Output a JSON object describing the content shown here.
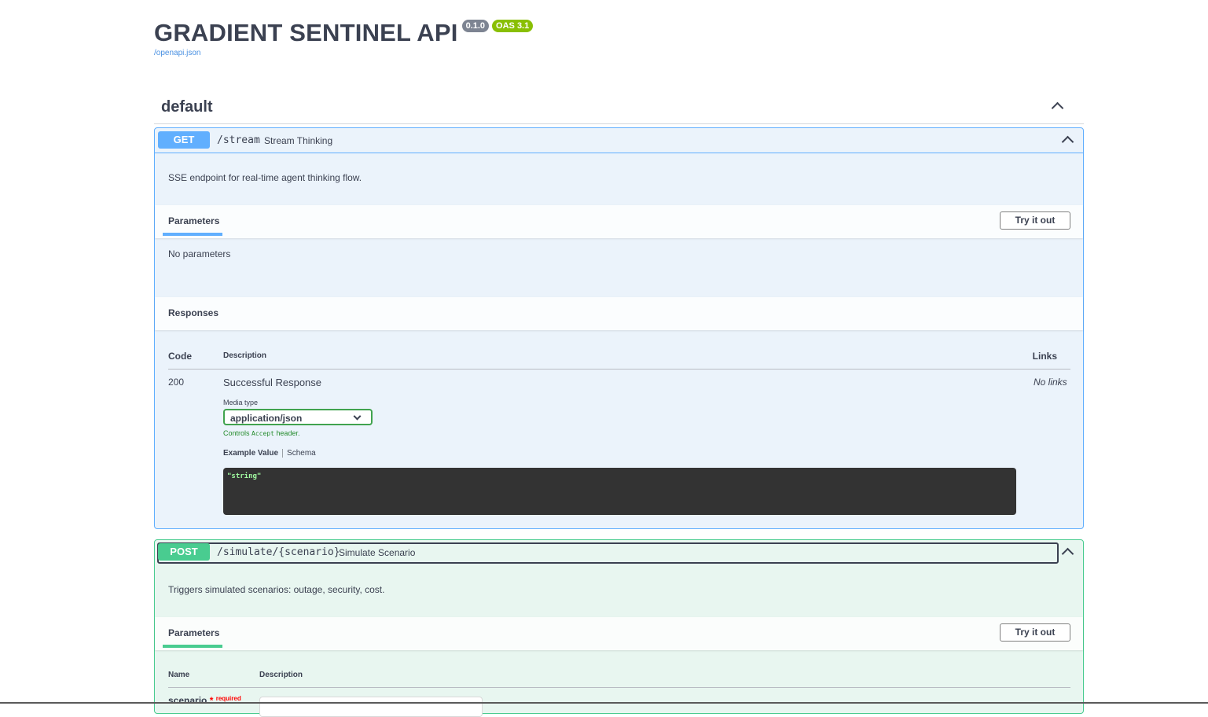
{
  "header": {
    "title": "GRADIENT SENTINEL API",
    "version_badge": "0.1.0",
    "oas_badge": "OAS 3.1",
    "spec_link": "/openapi.json"
  },
  "section": {
    "title": "default"
  },
  "operations": [
    {
      "method": "GET",
      "path": "/stream",
      "summary": "Stream Thinking",
      "description": "SSE endpoint for real-time agent thinking flow.",
      "parameters_tab": "Parameters",
      "try_button": "Try it out",
      "no_params": "No parameters",
      "responses_title": "Responses",
      "responses": {
        "col_code": "Code",
        "col_description": "Description",
        "col_links": "Links",
        "row": {
          "code": "200",
          "description": "Successful Response",
          "links": "No links",
          "media_type_label": "Media type",
          "media_type_value": "application/json",
          "controls_prefix": "Controls ",
          "controls_code": "Accept",
          "controls_suffix": " header.",
          "example_tab": "Example Value",
          "schema_tab": "Schema",
          "example_code": "\"string\""
        }
      }
    },
    {
      "method": "POST",
      "path": "/simulate/{scenario}",
      "summary": "Simulate Scenario",
      "description": "Triggers simulated scenarios: outage, security, cost.",
      "parameters_tab": "Parameters",
      "try_button": "Try it out",
      "param_col_name": "Name",
      "param_col_description": "Description",
      "param": {
        "name": "scenario",
        "required_star": "*",
        "required_label": "required"
      }
    }
  ],
  "colors": {
    "get": "#61affe",
    "post": "#49cc90",
    "version_badge": "#7d8492",
    "oas_badge": "#89bf04"
  }
}
